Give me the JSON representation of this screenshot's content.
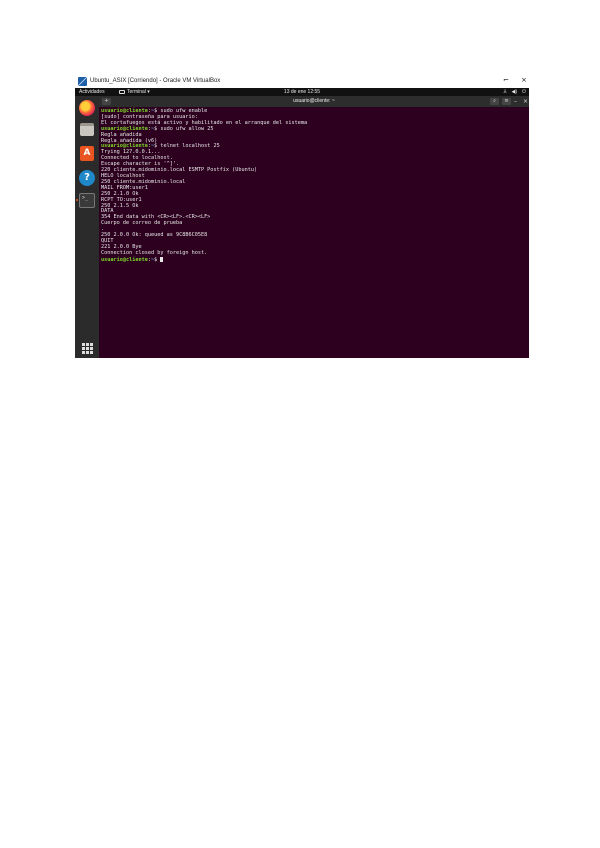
{
  "window": {
    "title": "Ubuntu_ASIX [Corriendo] - Oracle VM VirtualBox",
    "controls": {
      "restore": "⌐",
      "close": "×"
    }
  },
  "topbar": {
    "activities": "Actividades",
    "app_menu": "Terminal ▾",
    "clock": "13 de ene 12:55",
    "tray": [
      "⅄",
      "◀)",
      "⏻"
    ]
  },
  "dock": {
    "items": [
      {
        "name": "firefox",
        "icon": "firefox-icon"
      },
      {
        "name": "files",
        "icon": "files-icon"
      },
      {
        "name": "software",
        "icon": "ubuntu-software-icon",
        "glyph": "A"
      },
      {
        "name": "help",
        "icon": "help-icon",
        "glyph": "?"
      },
      {
        "name": "terminal",
        "icon": "terminal-icon",
        "glyph": ">_"
      }
    ]
  },
  "terminal_header": {
    "new_tab": "+",
    "title": "usuario@cliente: ~",
    "search": "⌕",
    "menu": "≡",
    "minimize": "–",
    "close": "×"
  },
  "terminal": {
    "lines": [
      {
        "user": "usuario@cliente",
        "path": "~",
        "cmd": " sudo ufw enable"
      },
      {
        "text": "[sudo] contraseña para usuario:"
      },
      {
        "text": "El cortafuegos está activo y habilitado en el arranque del sistema"
      },
      {
        "user": "usuario@cliente",
        "path": "~",
        "cmd": " sudo ufw allow 25"
      },
      {
        "text": "Regla añadida"
      },
      {
        "text": "Regla añadida (v6)"
      },
      {
        "user": "usuario@cliente",
        "path": "~",
        "cmd": " telnet localhost 25"
      },
      {
        "text": "Trying 127.0.0.1..."
      },
      {
        "text": "Connected to localhost."
      },
      {
        "text": "Escape character is '^]'."
      },
      {
        "text": "220 cliente.midominio.local ESMTP Postfix (Ubuntu)"
      },
      {
        "text": "HELO localhost"
      },
      {
        "text": "250 cliente.midominio.local"
      },
      {
        "text": "MAIL FROM:user1"
      },
      {
        "text": "250 2.1.0 Ok"
      },
      {
        "text": "RCPT TO:user1"
      },
      {
        "text": "250 2.1.5 Ok"
      },
      {
        "text": "DATA"
      },
      {
        "text": "354 End data with <CR><LF>.<CR><LF>"
      },
      {
        "text": "Cuerpo de correo de prueba"
      },
      {
        "text": "."
      },
      {
        "text": "250 2.0.0 Ok: queued as 9C8B6C05E8"
      },
      {
        "text": "QUIT"
      },
      {
        "text": "221 2.0.0 Bye"
      },
      {
        "text": "Connection closed by foreign host."
      },
      {
        "user": "usuario@cliente",
        "path": "~",
        "cmd": " ",
        "cursor": true
      }
    ]
  },
  "colors": {
    "terminal_bg": "#2c001e",
    "prompt_user": "#7fd62b",
    "prompt_path": "#6f9fd8",
    "ubuntu_orange": "#e95420"
  }
}
